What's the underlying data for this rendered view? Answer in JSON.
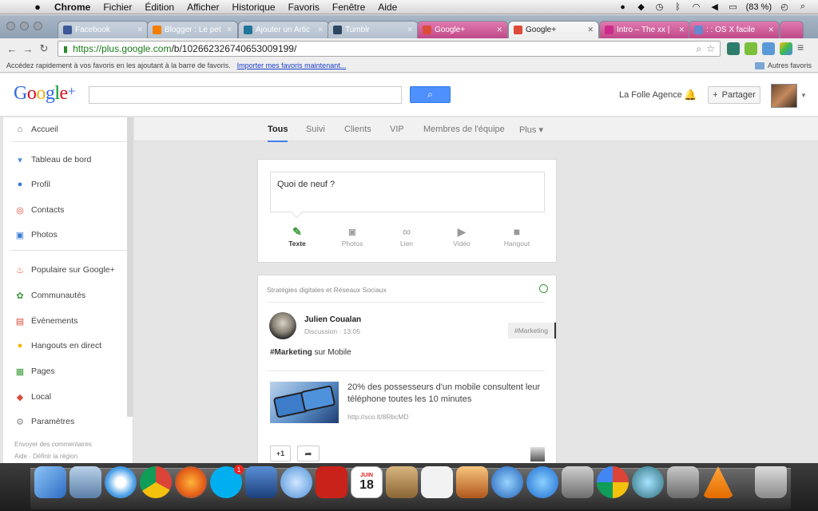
{
  "menubar": {
    "app": "Chrome",
    "items": [
      "Fichier",
      "Édition",
      "Afficher",
      "Historique",
      "Favoris",
      "Fenêtre",
      "Aide"
    ],
    "battery": "(83 %)"
  },
  "tabs": [
    {
      "label": "Facebook",
      "fav_color": "#3b5998"
    },
    {
      "label": "Blogger : Le pet",
      "fav_color": "#f57d00"
    },
    {
      "label": "Ajouter un Artic",
      "fav_color": "#21759b"
    },
    {
      "label": "Tumblr",
      "fav_color": "#2c4762"
    },
    {
      "label": "Google+",
      "fav_color": "#dd4b39"
    },
    {
      "label": "Google+",
      "fav_color": "#dd4b39"
    },
    {
      "label": "Intro – The xx |",
      "fav_color": "#cc2a8a"
    },
    {
      "label": ": : OS X facile",
      "fav_color": "#6688cc"
    }
  ],
  "toolbar": {
    "url_host": "https://plus.google.com",
    "url_path": "/b/102662326740653009199/"
  },
  "bookmarks": {
    "hint": "Accédez rapidement à vos favoris en les ajoutant à la barre de favoris.",
    "import_link": "Importer mes favoris maintenant...",
    "others": "Autres favoris"
  },
  "header": {
    "logo": {
      "g1": "G",
      "o1": "o",
      "o2": "o",
      "g2": "g",
      "l": "l",
      "e": "e",
      "plus": "+"
    },
    "agency": "La Folle Agence",
    "share": "Partager"
  },
  "sidebar": {
    "items": [
      {
        "label": "Accueil",
        "icon": "home-icon",
        "glyph": "⌂",
        "color": "#666"
      },
      {
        "label": "Tableau de bord",
        "icon": "dashboard-icon",
        "glyph": "▾",
        "color": "#4a89dc"
      },
      {
        "label": "Profil",
        "icon": "profile-icon",
        "glyph": "●",
        "color": "#3a7bd5"
      },
      {
        "label": "Contacts",
        "icon": "contacts-icon",
        "glyph": "◎",
        "color": "#dd4b39"
      },
      {
        "label": "Photos",
        "icon": "photos-icon",
        "glyph": "▣",
        "color": "#3a7bd5"
      },
      {
        "label": "Populaire sur Google+",
        "icon": "hot-icon",
        "glyph": "♨",
        "color": "#e8532a"
      },
      {
        "label": "Communautés",
        "icon": "communities-icon",
        "glyph": "✿",
        "color": "#3a9a3a"
      },
      {
        "label": "Événements",
        "icon": "events-icon",
        "glyph": "▤",
        "color": "#dd4b39"
      },
      {
        "label": "Hangouts en direct",
        "icon": "hangouts-icon",
        "glyph": "●",
        "color": "#f0b400"
      },
      {
        "label": "Pages",
        "icon": "pages-icon",
        "glyph": "▦",
        "color": "#3a9a3a"
      },
      {
        "label": "Local",
        "icon": "local-icon",
        "glyph": "◆",
        "color": "#dd4b39"
      },
      {
        "label": "Paramètres",
        "icon": "settings-icon",
        "glyph": "⚙",
        "color": "#888"
      }
    ],
    "feedback": "Envoyer des commentaires",
    "footer": "Aide · Définir la région"
  },
  "streams": [
    {
      "label": "Tous"
    },
    {
      "label": "Suivi"
    },
    {
      "label": "Clients"
    },
    {
      "label": "VIP"
    },
    {
      "label": "Membres de l'équipe"
    },
    {
      "label": "Plus ▾"
    }
  ],
  "composer": {
    "prompt": "Quoi de neuf ?",
    "actions": [
      {
        "label": "Texte",
        "icon": "pencil-icon",
        "glyph": "✎"
      },
      {
        "label": "Photos",
        "icon": "camera-icon",
        "glyph": "◙"
      },
      {
        "label": "Lien",
        "icon": "link-icon",
        "glyph": "∞"
      },
      {
        "label": "Vidéo",
        "icon": "video-icon",
        "glyph": "▶"
      },
      {
        "label": "Hangout",
        "icon": "hangout-camera-icon",
        "glyph": "■"
      }
    ]
  },
  "post": {
    "community": "Stratégies digitales et Réseaux Sociaux",
    "author": "Julien Coualan",
    "meta": "Discussion  ·  13:05",
    "tag": "#Marketing",
    "text_tag": "#Marketing",
    "text_rest": " sur Mobile",
    "link_title": "20% des possesseurs d'un mobile consultent leur téléphone toutes les 10 minutes",
    "link_url": "http://sco.lt/8RbcMD",
    "plusone": "+1"
  },
  "dock": {
    "skype_badge": "1",
    "calendar_month": "JUIN",
    "calendar_day": "18"
  }
}
